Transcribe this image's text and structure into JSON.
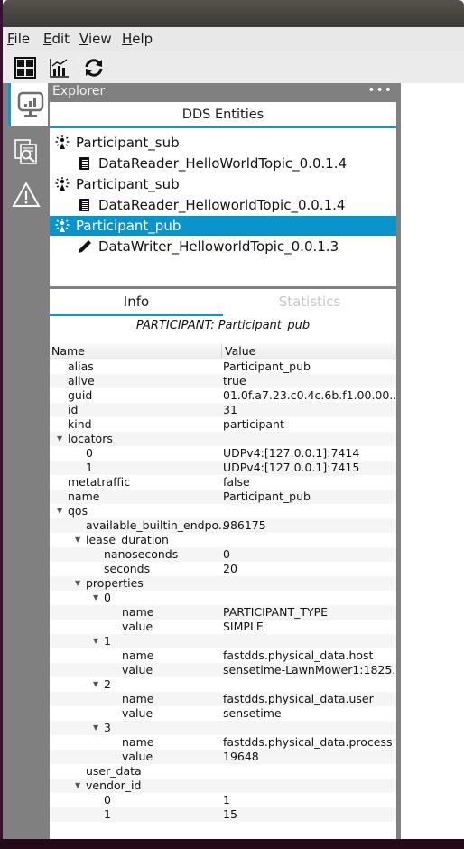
{
  "menu": {
    "items": [
      {
        "label": "File",
        "mnemonic": "F",
        "rest": "ile"
      },
      {
        "label": "Edit",
        "mnemonic": "E",
        "rest": "dit"
      },
      {
        "label": "View",
        "mnemonic": "V",
        "rest": "iew"
      },
      {
        "label": "Help",
        "mnemonic": "H",
        "rest": "elp"
      }
    ]
  },
  "toolbar": {
    "buttons": [
      {
        "icon": "grid-icon"
      },
      {
        "icon": "chart-icon"
      },
      {
        "icon": "refresh-icon"
      }
    ]
  },
  "rail": {
    "buttons": [
      {
        "icon": "monitor-chart-icon",
        "active": true
      },
      {
        "icon": "document-search-icon",
        "active": false
      },
      {
        "icon": "warning-icon",
        "active": false
      }
    ]
  },
  "explorer": {
    "title": "Explorer",
    "more": "•••",
    "entities_title": "DDS Entities",
    "tree": [
      {
        "label": "Participant_sub",
        "icon": "participant-icon",
        "level": 0,
        "selected": false
      },
      {
        "label": "DataReader_HelloWorldTopic_0.0.1.4",
        "icon": "datareader-icon",
        "level": 1,
        "selected": false
      },
      {
        "label": "Participant_sub",
        "icon": "participant-icon",
        "level": 0,
        "selected": false
      },
      {
        "label": "DataReader_HelloworldTopic_0.0.1.4",
        "icon": "datareader-icon",
        "level": 1,
        "selected": false
      },
      {
        "label": "Participant_pub",
        "icon": "participant-icon",
        "level": 0,
        "selected": true
      },
      {
        "label": "DataWriter_HelloworldTopic_0.0.1.3",
        "icon": "datawriter-icon",
        "level": 1,
        "selected": false
      }
    ]
  },
  "info": {
    "tabs": [
      {
        "label": "Info",
        "active": true
      },
      {
        "label": "Statistics",
        "active": false
      }
    ],
    "caption": "PARTICIPANT: Participant_pub",
    "columns": {
      "name": "Name",
      "value": "Value"
    },
    "rows": [
      {
        "name": "alias",
        "value": "Participant_pub",
        "depth": 1,
        "expandable": false
      },
      {
        "name": "alive",
        "value": "true",
        "depth": 1,
        "expandable": false
      },
      {
        "name": "guid",
        "value": "01.0f.a7.23.c0.4c.6b.f1.00.00....",
        "depth": 1,
        "expandable": false
      },
      {
        "name": "id",
        "value": "31",
        "depth": 1,
        "expandable": false
      },
      {
        "name": "kind",
        "value": "participant",
        "depth": 1,
        "expandable": false
      },
      {
        "name": "locators",
        "value": "",
        "depth": 1,
        "expandable": true
      },
      {
        "name": "0",
        "value": "UDPv4:[127.0.0.1]:7414",
        "depth": 2,
        "expandable": false
      },
      {
        "name": "1",
        "value": "UDPv4:[127.0.0.1]:7415",
        "depth": 2,
        "expandable": false
      },
      {
        "name": "metatraffic",
        "value": "false",
        "depth": 1,
        "expandable": false
      },
      {
        "name": "name",
        "value": "Participant_pub",
        "depth": 1,
        "expandable": false
      },
      {
        "name": "qos",
        "value": "",
        "depth": 1,
        "expandable": true
      },
      {
        "name": "available_builtin_endpo...",
        "value": "986175",
        "depth": 2,
        "expandable": false
      },
      {
        "name": "lease_duration",
        "value": "",
        "depth": 2,
        "expandable": true
      },
      {
        "name": "nanoseconds",
        "value": "0",
        "depth": 3,
        "expandable": false
      },
      {
        "name": "seconds",
        "value": "20",
        "depth": 3,
        "expandable": false
      },
      {
        "name": "properties",
        "value": "",
        "depth": 2,
        "expandable": true
      },
      {
        "name": "0",
        "value": "",
        "depth": 3,
        "expandable": true
      },
      {
        "name": "name",
        "value": "PARTICIPANT_TYPE",
        "depth": 4,
        "expandable": false
      },
      {
        "name": "value",
        "value": "SIMPLE",
        "depth": 4,
        "expandable": false
      },
      {
        "name": "1",
        "value": "",
        "depth": 3,
        "expandable": true
      },
      {
        "name": "name",
        "value": "fastdds.physical_data.host",
        "depth": 4,
        "expandable": false
      },
      {
        "name": "value",
        "value": "sensetime-LawnMower1:1825...",
        "depth": 4,
        "expandable": false
      },
      {
        "name": "2",
        "value": "",
        "depth": 3,
        "expandable": true
      },
      {
        "name": "name",
        "value": "fastdds.physical_data.user",
        "depth": 4,
        "expandable": false
      },
      {
        "name": "value",
        "value": "sensetime",
        "depth": 4,
        "expandable": false
      },
      {
        "name": "3",
        "value": "",
        "depth": 3,
        "expandable": true
      },
      {
        "name": "name",
        "value": "fastdds.physical_data.process",
        "depth": 4,
        "expandable": false
      },
      {
        "name": "value",
        "value": "19648",
        "depth": 4,
        "expandable": false
      },
      {
        "name": "user_data",
        "value": "",
        "depth": 2,
        "expandable": false
      },
      {
        "name": "vendor_id",
        "value": "",
        "depth": 2,
        "expandable": true
      },
      {
        "name": "0",
        "value": "1",
        "depth": 3,
        "expandable": false
      },
      {
        "name": "1",
        "value": "15",
        "depth": 3,
        "expandable": false
      }
    ]
  },
  "colors": {
    "accent": "#0b94cc",
    "panel_gray": "#808080",
    "menubar": "#e8e8e8"
  }
}
